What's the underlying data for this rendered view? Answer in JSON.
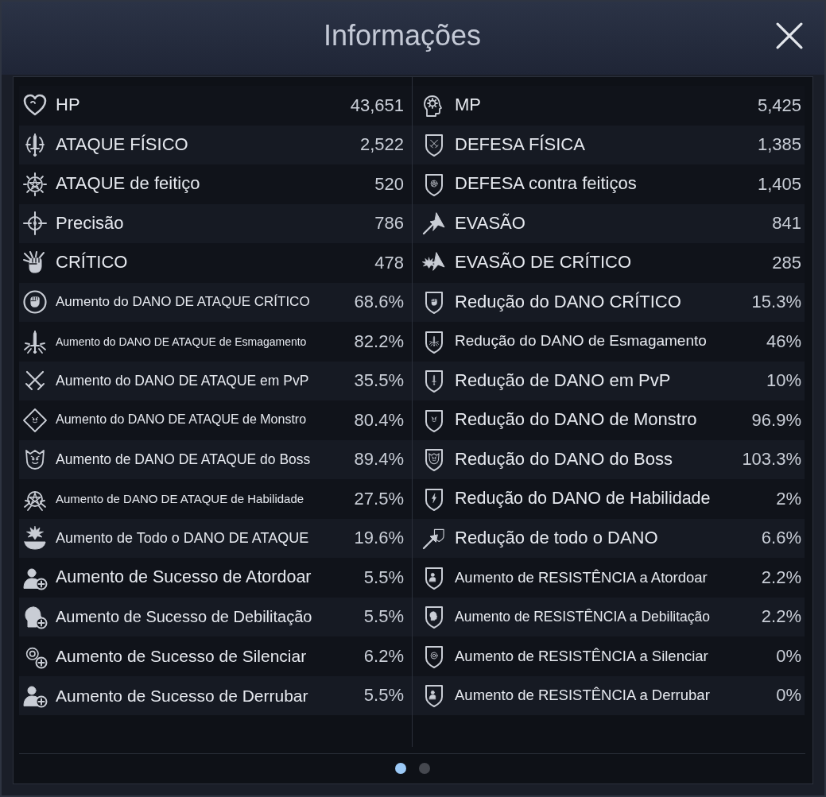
{
  "dialog": {
    "title": "Informações"
  },
  "stat_columns": [
    {
      "rows": [
        {
          "label": "HP",
          "value": "43,651"
        },
        {
          "label": "ATAQUE FÍSICO",
          "value": "2,522"
        },
        {
          "label": "ATAQUE de feitiço",
          "value": "520"
        },
        {
          "label": "Precisão",
          "value": "786"
        },
        {
          "label": "CRÍTICO",
          "value": "478"
        },
        {
          "label": "Aumento do DANO DE ATAQUE CRÍTICO",
          "value": "68.6%"
        },
        {
          "label": "Aumento do DANO DE ATAQUE de Esmagamento",
          "value": "82.2%"
        },
        {
          "label": "Aumento do DANO DE ATAQUE em PvP",
          "value": "35.5%"
        },
        {
          "label": "Aumento do DANO DE ATAQUE de Monstro",
          "value": "80.4%"
        },
        {
          "label": "Aumento de DANO DE ATAQUE do Boss",
          "value": "89.4%"
        },
        {
          "label": "Aumento de DANO DE ATAQUE de Habilidade",
          "value": "27.5%"
        },
        {
          "label": "Aumento de Todo o DANO DE ATAQUE",
          "value": "19.6%"
        },
        {
          "label": "Aumento de Sucesso de Atordoar",
          "value": "5.5%"
        },
        {
          "label": "Aumento de Sucesso de Debilitação",
          "value": "5.5%"
        },
        {
          "label": "Aumento de Sucesso de Silenciar",
          "value": "6.2%"
        },
        {
          "label": "Aumento de Sucesso de Derrubar",
          "value": "5.5%"
        }
      ]
    },
    {
      "rows": [
        {
          "label": "MP",
          "value": "5,425"
        },
        {
          "label": "DEFESA FÍSICA",
          "value": "1,385"
        },
        {
          "label": "DEFESA contra feitiços",
          "value": "1,405"
        },
        {
          "label": "EVASÃO",
          "value": "841"
        },
        {
          "label": "EVASÃO DE CRÍTICO",
          "value": "285"
        },
        {
          "label": "Redução do DANO CRÍTICO",
          "value": "15.3%"
        },
        {
          "label": "Redução do DANO de Esmagamento",
          "value": "46%"
        },
        {
          "label": "Redução de DANO em PvP",
          "value": "10%"
        },
        {
          "label": "Redução do DANO de Monstro",
          "value": "96.9%"
        },
        {
          "label": "Redução do DANO do Boss",
          "value": "103.3%"
        },
        {
          "label": "Redução do DANO de Habilidade",
          "value": "2%"
        },
        {
          "label": "Redução de todo o DANO",
          "value": "6.6%"
        },
        {
          "label": "Aumento de RESISTÊNCIA a Atordoar",
          "value": "2.2%"
        },
        {
          "label": "Aumento de RESISTÊNCIA a Debilitação",
          "value": "2.2%"
        },
        {
          "label": "Aumento de RESISTÊNCIA a Silenciar",
          "value": "0%"
        },
        {
          "label": "Aumento de RESISTÊNCIA a Derrubar",
          "value": "0%"
        }
      ]
    }
  ],
  "pager": [
    {
      "selected": true
    },
    {
      "selected": false
    }
  ]
}
